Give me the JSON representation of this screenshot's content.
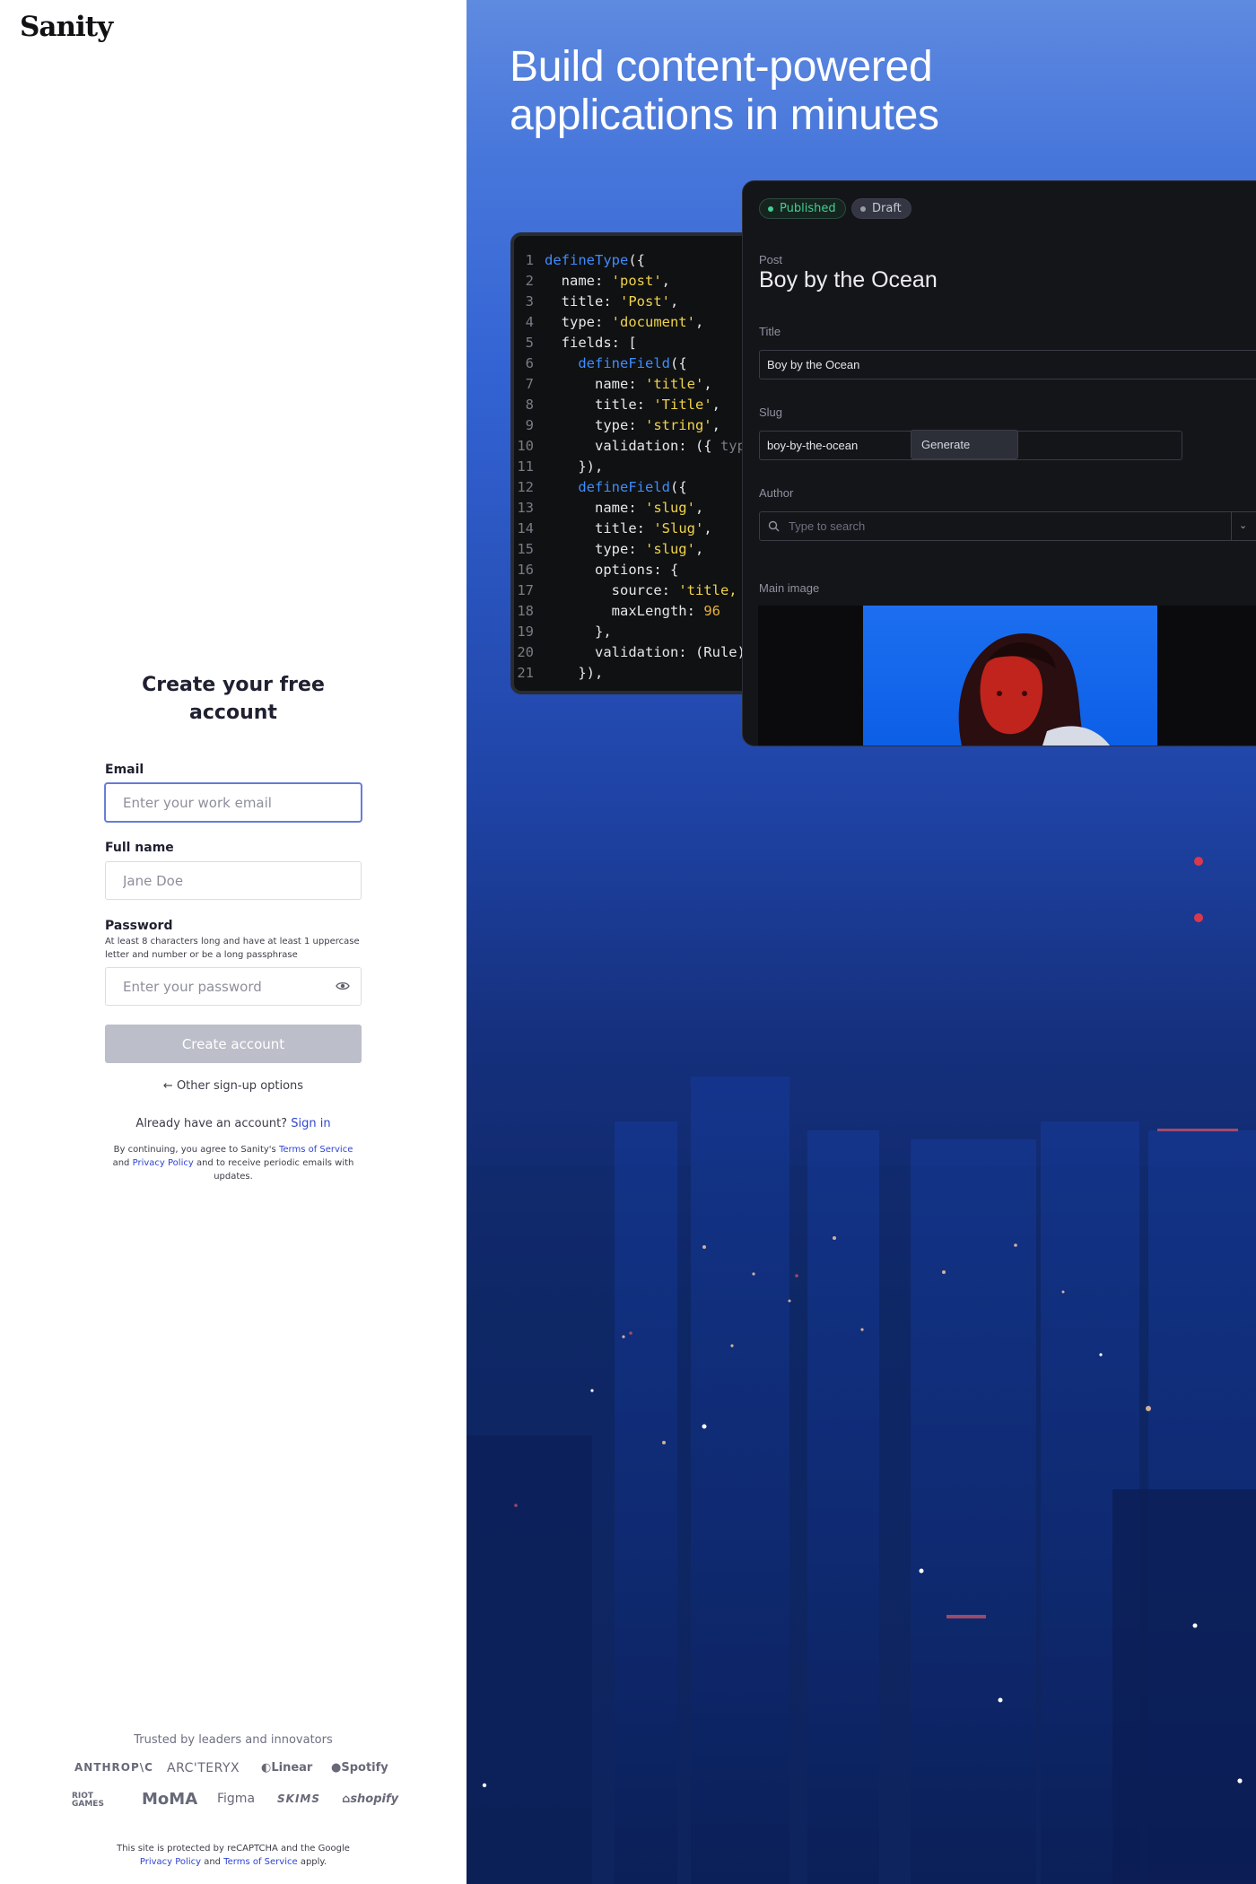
{
  "brand": {
    "logo_text": "Sanity"
  },
  "signup": {
    "heading": "Create your free account",
    "email": {
      "label": "Email",
      "placeholder": "Enter your work email",
      "value": ""
    },
    "full_name": {
      "label": "Full name",
      "placeholder": "Jane Doe",
      "value": ""
    },
    "password": {
      "label": "Password",
      "hint": "At least 8 characters long and have at least 1 uppercase letter and number or be a long passphrase",
      "placeholder": "Enter your password",
      "value": ""
    },
    "create_button": "Create account",
    "other_options": "Other sign-up options",
    "already_text": "Already have an account?",
    "sign_in": "Sign in",
    "legal": {
      "prefix": "By continuing, you agree to Sanity's",
      "terms": "Terms of Service",
      "and": "and",
      "privacy": "Privacy Policy",
      "suffix": "and to receive periodic emails with updates."
    }
  },
  "trusted": {
    "title": "Trusted by leaders and innovators",
    "logos_row1": [
      "ANTHROP\\C",
      "ARC'TERYX",
      "Linear",
      "Spotify"
    ],
    "logos_row2": [
      "RIOT GAMES",
      "MoMA",
      "Figma",
      "SKIMS",
      "shopify"
    ]
  },
  "recaptcha": {
    "text": "This site is protected by reCAPTCHA and the Google",
    "privacy": "Privacy Policy",
    "and": "and",
    "terms": "Terms of Service",
    "suffix": "apply."
  },
  "hero": {
    "headline_line1": "Build content-powered",
    "headline_line2": "applications in minutes"
  },
  "code_editor": {
    "lines": [
      "defineType({",
      "  name: 'post',",
      "  title: 'Post',",
      "  type: 'document',",
      "  fields: [",
      "    defineField({",
      "      name: 'title',",
      "      title: 'Title',",
      "      type: 'string',",
      "      validation: ({ typ",
      "    }),",
      "    defineField({",
      "      name: 'slug',",
      "      title: 'Slug',",
      "      type: 'slug',",
      "      options: {",
      "        source: 'title,",
      "        maxLength: 96",
      "      },",
      "      validation: (Rule)",
      "    }),"
    ]
  },
  "studio": {
    "status_published": "Published",
    "status_draft": "Draft",
    "doc_type": "Post",
    "doc_title": "Boy by the Ocean",
    "title_field": {
      "label": "Title",
      "value": "Boy by the Ocean"
    },
    "slug_field": {
      "label": "Slug",
      "value": "boy-by-the-ocean",
      "generate": "Generate"
    },
    "author_field": {
      "label": "Author",
      "placeholder": "Type to search"
    },
    "image_field": {
      "label": "Main image"
    },
    "colors": {
      "published": "#42cf94",
      "draft": "#9a9caa"
    }
  }
}
